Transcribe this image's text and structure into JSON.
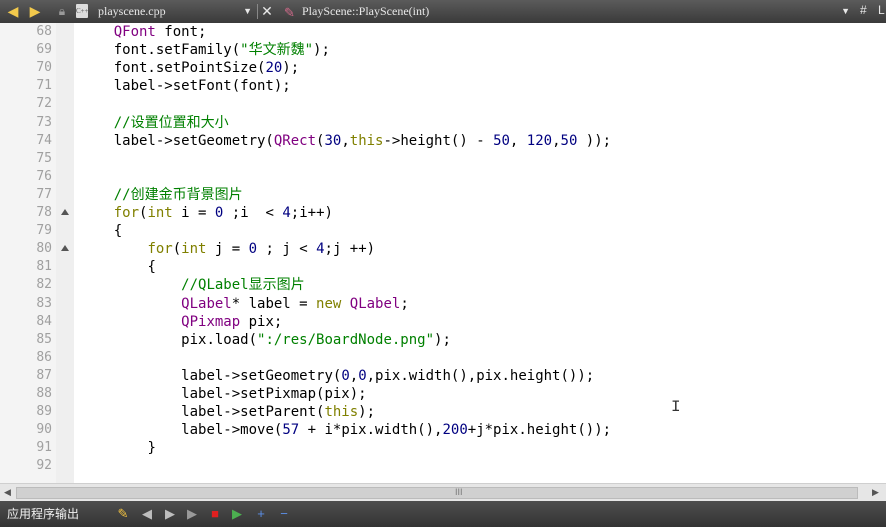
{
  "top_bar": {
    "back_icon": "left-arrow-icon",
    "forward_icon": "right-arrow-icon",
    "file_name": "playscene.cpp",
    "function_name": "PlayScene::PlayScene(int)",
    "dropdown_glyph": "▼",
    "close_glyph": "✕",
    "hash_glyph": "#",
    "more_glyph": "L"
  },
  "editor": {
    "lines": [
      {
        "number": "68",
        "indent": "    ",
        "tokens": [
          {
            "t": "QFont",
            "c": "type"
          },
          {
            "t": " font;",
            "c": "plain"
          }
        ]
      },
      {
        "number": "69",
        "indent": "    ",
        "tokens": [
          {
            "t": "font.setFamily(",
            "c": "plain"
          },
          {
            "t": "\"华文新魏\"",
            "c": "str"
          },
          {
            "t": ");",
            "c": "plain"
          }
        ]
      },
      {
        "number": "70",
        "indent": "    ",
        "tokens": [
          {
            "t": "font.setPointSize(",
            "c": "plain"
          },
          {
            "t": "20",
            "c": "num"
          },
          {
            "t": ");",
            "c": "plain"
          }
        ]
      },
      {
        "number": "71",
        "indent": "    ",
        "tokens": [
          {
            "t": "label->setFont(font);",
            "c": "plain"
          }
        ]
      },
      {
        "number": "72",
        "indent": "",
        "tokens": []
      },
      {
        "number": "73",
        "indent": "    ",
        "tokens": [
          {
            "t": "//设置位置和大小",
            "c": "cm"
          }
        ]
      },
      {
        "number": "74",
        "indent": "    ",
        "tokens": [
          {
            "t": "label->setGeometry(",
            "c": "plain"
          },
          {
            "t": "QRect",
            "c": "type"
          },
          {
            "t": "(",
            "c": "plain"
          },
          {
            "t": "30",
            "c": "num"
          },
          {
            "t": ",",
            "c": "plain"
          },
          {
            "t": "this",
            "c": "kw"
          },
          {
            "t": "->height() - ",
            "c": "plain"
          },
          {
            "t": "50",
            "c": "num"
          },
          {
            "t": ", ",
            "c": "plain"
          },
          {
            "t": "120",
            "c": "num"
          },
          {
            "t": ",",
            "c": "plain"
          },
          {
            "t": "50",
            "c": "num"
          },
          {
            "t": " ));",
            "c": "plain"
          }
        ]
      },
      {
        "number": "75",
        "indent": "",
        "tokens": []
      },
      {
        "number": "76",
        "indent": "",
        "tokens": []
      },
      {
        "number": "77",
        "indent": "    ",
        "tokens": [
          {
            "t": "//创建金币背景图片",
            "c": "cm"
          }
        ]
      },
      {
        "number": "78",
        "indent": "    ",
        "fold": true,
        "tokens": [
          {
            "t": "for",
            "c": "kw"
          },
          {
            "t": "(",
            "c": "plain"
          },
          {
            "t": "int",
            "c": "kw"
          },
          {
            "t": " i = ",
            "c": "plain"
          },
          {
            "t": "0",
            "c": "num"
          },
          {
            "t": " ;i  < ",
            "c": "plain"
          },
          {
            "t": "4",
            "c": "num"
          },
          {
            "t": ";i++)",
            "c": "plain"
          }
        ]
      },
      {
        "number": "79",
        "indent": "    ",
        "tokens": [
          {
            "t": "{",
            "c": "plain"
          }
        ]
      },
      {
        "number": "80",
        "indent": "        ",
        "fold": true,
        "tokens": [
          {
            "t": "for",
            "c": "kw"
          },
          {
            "t": "(",
            "c": "plain"
          },
          {
            "t": "int",
            "c": "kw"
          },
          {
            "t": " j = ",
            "c": "plain"
          },
          {
            "t": "0",
            "c": "num"
          },
          {
            "t": " ; j < ",
            "c": "plain"
          },
          {
            "t": "4",
            "c": "num"
          },
          {
            "t": ";j ++)",
            "c": "plain"
          }
        ]
      },
      {
        "number": "81",
        "indent": "        ",
        "tokens": [
          {
            "t": "{",
            "c": "plain"
          }
        ]
      },
      {
        "number": "82",
        "indent": "            ",
        "tokens": [
          {
            "t": "//QLabel显示图片",
            "c": "cm"
          }
        ]
      },
      {
        "number": "83",
        "indent": "            ",
        "tokens": [
          {
            "t": "QLabel",
            "c": "type"
          },
          {
            "t": "* label = ",
            "c": "plain"
          },
          {
            "t": "new",
            "c": "kw"
          },
          {
            "t": " ",
            "c": "plain"
          },
          {
            "t": "QLabel",
            "c": "type"
          },
          {
            "t": ";",
            "c": "plain"
          }
        ]
      },
      {
        "number": "84",
        "indent": "            ",
        "tokens": [
          {
            "t": "QPixmap",
            "c": "type"
          },
          {
            "t": " pix;",
            "c": "plain"
          }
        ]
      },
      {
        "number": "85",
        "indent": "            ",
        "tokens": [
          {
            "t": "pix.load(",
            "c": "plain"
          },
          {
            "t": "\":/res/BoardNode.png\"",
            "c": "str"
          },
          {
            "t": ");",
            "c": "plain"
          }
        ]
      },
      {
        "number": "86",
        "indent": "",
        "tokens": []
      },
      {
        "number": "87",
        "indent": "            ",
        "tokens": [
          {
            "t": "label->setGeometry(",
            "c": "plain"
          },
          {
            "t": "0",
            "c": "num"
          },
          {
            "t": ",",
            "c": "plain"
          },
          {
            "t": "0",
            "c": "num"
          },
          {
            "t": ",pix.width(),pix.height());",
            "c": "plain"
          }
        ]
      },
      {
        "number": "88",
        "indent": "            ",
        "tokens": [
          {
            "t": "label->setPixmap(pix);",
            "c": "plain"
          }
        ]
      },
      {
        "number": "89",
        "indent": "            ",
        "tokens": [
          {
            "t": "label->setParent(",
            "c": "plain"
          },
          {
            "t": "this",
            "c": "kw"
          },
          {
            "t": ");",
            "c": "plain"
          }
        ]
      },
      {
        "number": "90",
        "indent": "            ",
        "tokens": [
          {
            "t": "label->move(",
            "c": "plain"
          },
          {
            "t": "57",
            "c": "num"
          },
          {
            "t": " + i*pix.width(),",
            "c": "plain"
          },
          {
            "t": "200",
            "c": "num"
          },
          {
            "t": "+j*pix.height());",
            "c": "plain"
          }
        ]
      },
      {
        "number": "91",
        "indent": "        ",
        "tokens": [
          {
            "t": "}",
            "c": "plain"
          }
        ]
      },
      {
        "number": "92",
        "indent": "",
        "tokens": []
      }
    ]
  },
  "scrollbar": {
    "left_glyph": "◀",
    "right_glyph": "▶",
    "grip_glyph": "III"
  },
  "bottom_bar": {
    "title": "应用程序输出",
    "buttons": [
      {
        "name": "clear-output-button",
        "icon": "broom-icon",
        "glyph": "✎",
        "color": "#f0c040"
      },
      {
        "name": "previous-item-button",
        "icon": "left-triangle-icon",
        "glyph": "◀",
        "color": "#bdbdbd"
      },
      {
        "name": "next-item-button",
        "icon": "right-triangle-icon",
        "glyph": "▶",
        "color": "#bdbdbd"
      },
      {
        "name": "run-button",
        "icon": "play-icon",
        "glyph": "▶",
        "color": "#9a9a9a"
      },
      {
        "name": "stop-button",
        "icon": "stop-icon",
        "glyph": "■",
        "color": "#e02020"
      },
      {
        "name": "attach-debugger-button",
        "icon": "debug-run-icon",
        "glyph": "▶",
        "color": "#4caf50"
      },
      {
        "name": "zoom-in-button",
        "icon": "plus-icon",
        "glyph": "+",
        "color": "#5b8fe8"
      },
      {
        "name": "zoom-out-button",
        "icon": "minus-icon",
        "glyph": "−",
        "color": "#5b8fe8"
      }
    ]
  }
}
